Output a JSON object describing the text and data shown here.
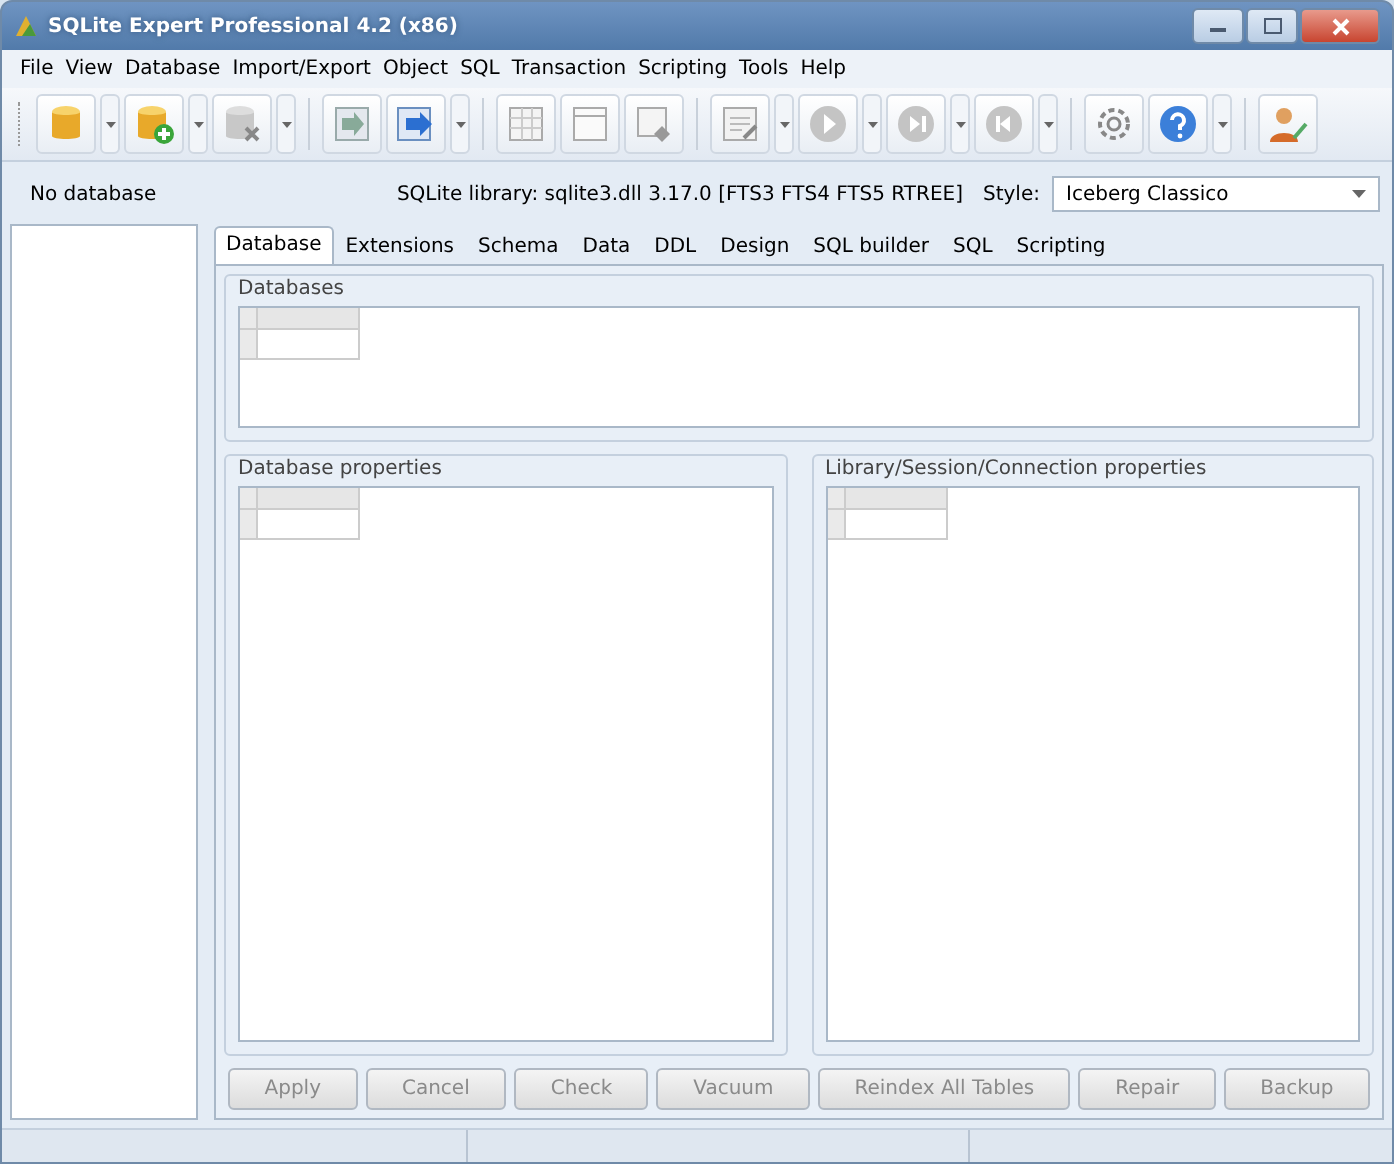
{
  "window": {
    "title": "SQLite Expert Professional 4.2 (x86)"
  },
  "menu": [
    "File",
    "View",
    "Database",
    "Import/Export",
    "Object",
    "SQL",
    "Transaction",
    "Scripting",
    "Tools",
    "Help"
  ],
  "info_bar": {
    "database": "No database",
    "library": "SQLite library: sqlite3.dll 3.17.0 [FTS3 FTS4 FTS5 RTREE]",
    "style_label": "Style:",
    "style_value": "Iceberg Classico"
  },
  "tabs": [
    {
      "label": "Database",
      "selected": true
    },
    {
      "label": "Extensions",
      "selected": false
    },
    {
      "label": "Schema",
      "selected": false
    },
    {
      "label": "Data",
      "selected": false
    },
    {
      "label": "DDL",
      "selected": false
    },
    {
      "label": "Design",
      "selected": false
    },
    {
      "label": "SQL builder",
      "selected": false
    },
    {
      "label": "SQL",
      "selected": false
    },
    {
      "label": "Scripting",
      "selected": false
    }
  ],
  "groups": [
    {
      "title": "Databases"
    },
    {
      "title": "Database properties"
    },
    {
      "title": "Library/Session/Connection properties"
    }
  ],
  "buttons": [
    {
      "label": "Apply",
      "disabled": true
    },
    {
      "label": "Cancel",
      "disabled": true
    },
    {
      "label": "Check",
      "disabled": true
    },
    {
      "label": "Vacuum",
      "disabled": true
    },
    {
      "label": "Reindex All Tables",
      "disabled": true
    },
    {
      "label": "Repair",
      "disabled": true
    },
    {
      "label": "Backup",
      "disabled": true
    }
  ]
}
